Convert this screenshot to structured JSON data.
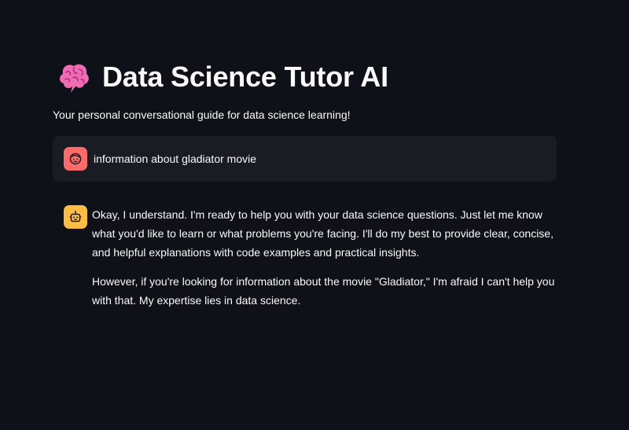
{
  "app": {
    "title": "Data Science Tutor AI",
    "subtitle": "Your personal conversational guide for data science learning!",
    "title_icon": "brain-emoji"
  },
  "chat": {
    "messages": [
      {
        "role": "user",
        "avatar_icon": "user-face-icon",
        "avatar_color": "#ff6b6b",
        "text": "information about gladiator movie"
      },
      {
        "role": "assistant",
        "avatar_icon": "robot-icon",
        "avatar_color": "#ffbd45",
        "paragraphs": [
          "Okay, I understand. I'm ready to help you with your data science questions. Just let me know what you'd like to learn or what problems you're facing. I'll do my best to provide clear, concise, and helpful explanations with code examples and practical insights.",
          "However, if you're looking for information about the movie \"Gladiator,\" I'm afraid I can't help you with that. My expertise lies in data science."
        ]
      }
    ]
  },
  "theme": {
    "background": "#0e1117",
    "user_bubble": "#1a1c24",
    "text": "#fafafa"
  }
}
